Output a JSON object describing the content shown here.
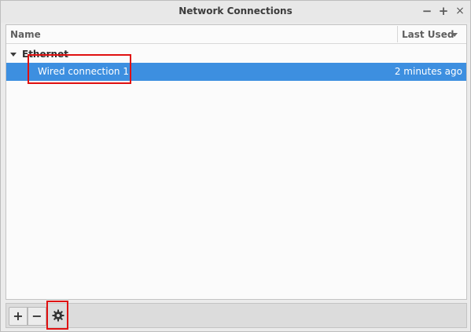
{
  "window": {
    "title": "Network Connections",
    "controls": {
      "minimize": "−",
      "maximize": "+",
      "close": "×"
    }
  },
  "list": {
    "columns": {
      "name": "Name",
      "last_used": "Last Used"
    },
    "groups": [
      {
        "label": "Ethernet",
        "items": [
          {
            "name": "Wired connection 1",
            "last_used": "2 minutes ago",
            "selected": true
          }
        ]
      }
    ]
  },
  "toolbar": {
    "add_label": "+",
    "remove_label": "−",
    "settings_icon": "gear-icon"
  },
  "colors": {
    "selection": "#3d8fe0",
    "highlight_box": "#e01010"
  }
}
